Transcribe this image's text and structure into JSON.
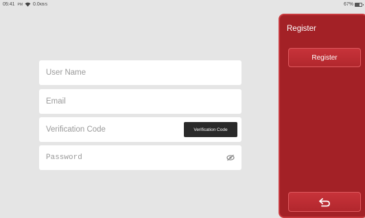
{
  "status": {
    "time": "05:41",
    "ampm": "PM",
    "network": "0.0",
    "network_unit": "KB/S",
    "battery": "67%",
    "battery_level": 0.67
  },
  "form": {
    "username_placeholder": "User Name",
    "email_placeholder": "Email",
    "code_placeholder": "Verification Code",
    "code_button": "Verification Code",
    "password_placeholder": "Password"
  },
  "panel": {
    "title": "Register",
    "register_button": "Register",
    "back_icon": "back-arrow-icon"
  },
  "colors": {
    "panel_bg": "#a32126",
    "button_bg": "#c7333a",
    "page_bg": "#e5e5e5"
  }
}
